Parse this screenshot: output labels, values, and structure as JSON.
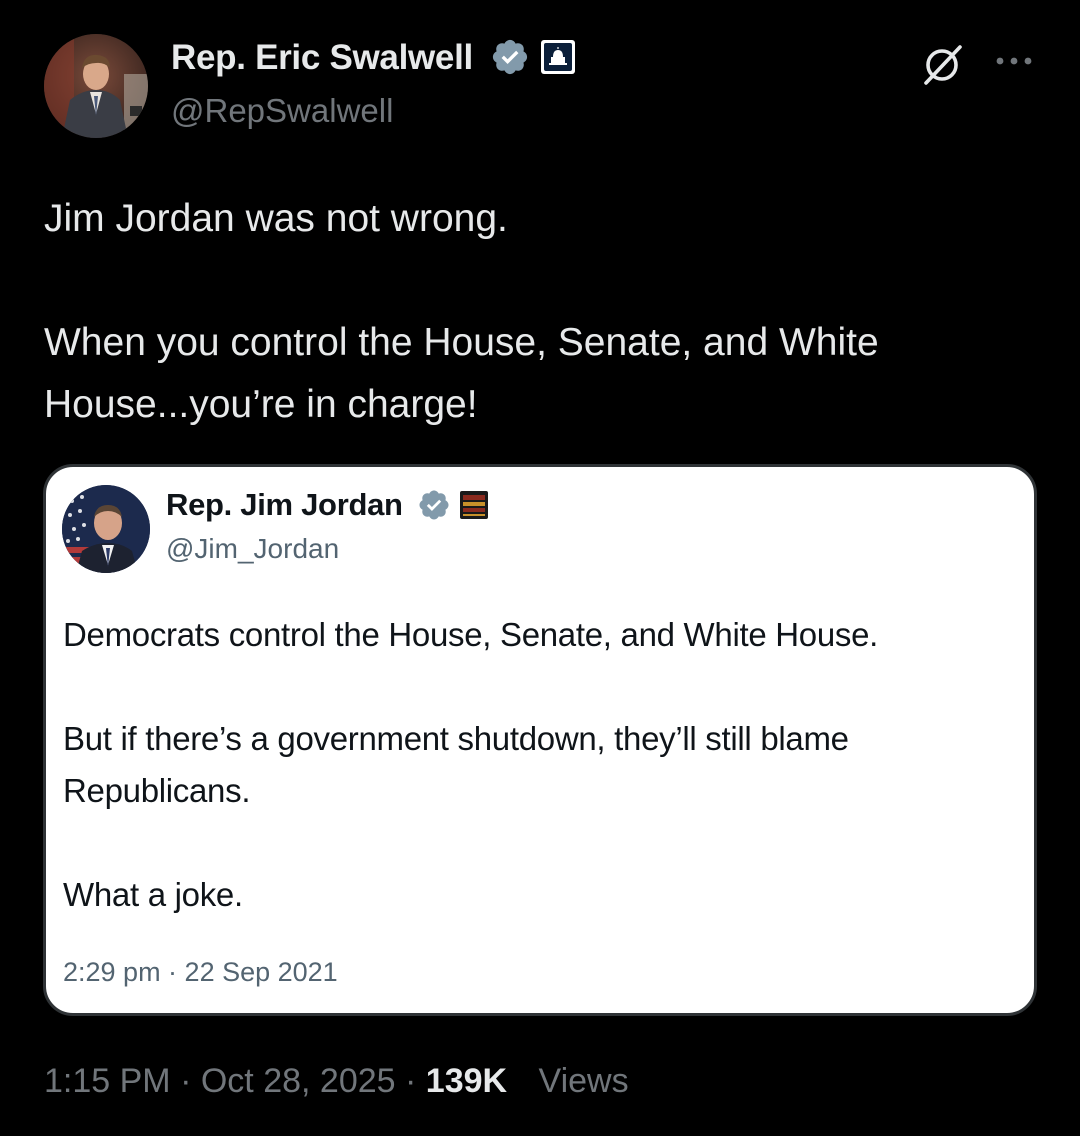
{
  "tweet": {
    "author": {
      "name": "Rep. Eric Swalwell",
      "handle": "@RepSwalwell",
      "verified_color": "#829aab",
      "affiliation_badge": "capitol-building-icon"
    },
    "text_paragraphs": [
      "Jim Jordan was not wrong.",
      "When you control the House, Senate, and White House...you’re in charge!"
    ],
    "time": "1:15 PM",
    "date": "Oct 28, 2025",
    "views_count": "139K",
    "views_label": "Views"
  },
  "quoted_tweet": {
    "author": {
      "name": "Rep. Jim Jordan",
      "handle": "@Jim_Jordan",
      "verified_color": "#829aab",
      "affiliation_badge": "house-badge-icon"
    },
    "text_paragraphs": [
      "Democrats control the House, Senate, and White House.",
      "But if there’s a government shutdown, they’ll still blame\nRepublicans.",
      "What a joke."
    ],
    "timestamp": "2:29 pm · 22 Sep 2021"
  },
  "icons": {
    "grok": "grok-icon",
    "more": "more-options-icon"
  }
}
